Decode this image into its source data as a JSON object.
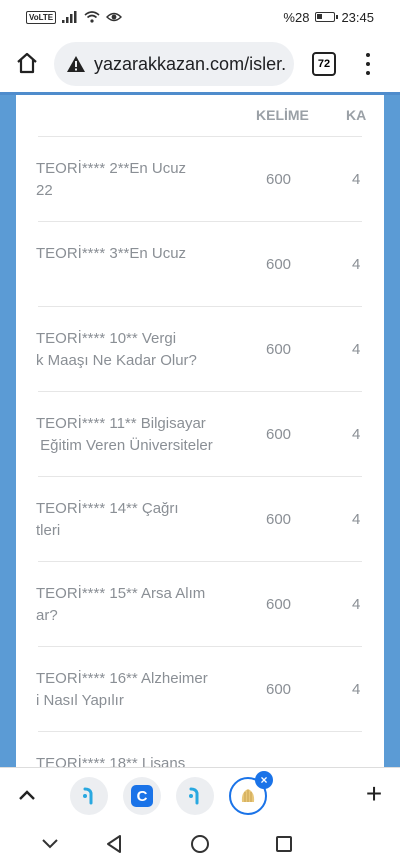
{
  "status": {
    "carrier_badge": "VoLTE",
    "battery_percent": "%28",
    "battery_level": 0.28,
    "time": "23:45"
  },
  "browser": {
    "url": "yazarakkazan.com/isler.",
    "tab_count": "72"
  },
  "table": {
    "columns": [
      "KELİME",
      "KA"
    ],
    "rows": [
      {
        "title": "TEORİ**** 2**En Ucuz\n22",
        "words": "600",
        "extra": "4"
      },
      {
        "title": "TEORİ**** 3**En Ucuz",
        "words": "600",
        "extra": "4"
      },
      {
        "title": "TEORİ**** 10** Vergi\nk Maaşı Ne Kadar Olur?",
        "words": "600",
        "extra": "4"
      },
      {
        "title": "TEORİ**** 11** Bilgisayar\n Eğitim Veren Üniversiteler",
        "words": "600",
        "extra": "4"
      },
      {
        "title": "TEORİ**** 14** Çağrı\ntleri",
        "words": "600",
        "extra": "4"
      },
      {
        "title": "TEORİ**** 15** Arsa Alım\nar?",
        "words": "600",
        "extra": "4"
      },
      {
        "title": "TEORİ**** 16** Alzheimer\ni Nasıl Yapılır",
        "words": "600",
        "extra": "4"
      },
      {
        "title": "TEORİ**** 18** Lisans",
        "words": "",
        "extra": ""
      }
    ]
  },
  "tabs": {
    "active_close": "×",
    "c_letter": "C",
    "plus": "+"
  },
  "colors": {
    "page_bg": "#5b9bd5",
    "accent": "#1a73e8",
    "muted_text": "#8a8f95"
  }
}
